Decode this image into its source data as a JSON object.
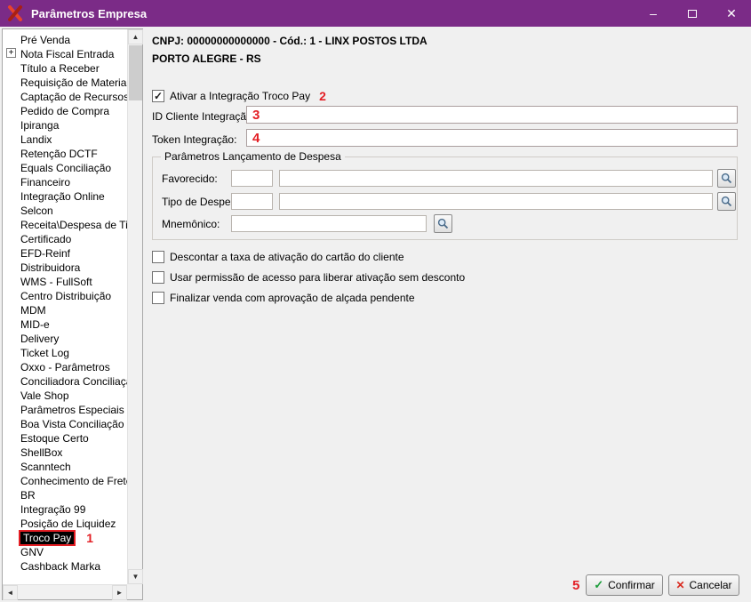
{
  "window": {
    "title": "Parâmetros Empresa"
  },
  "icons": {
    "minimize": "–",
    "close": "✕",
    "scroll_up": "▲",
    "scroll_down": "▼",
    "scroll_left": "◄",
    "scroll_right": "►",
    "expand": "+",
    "check": "✓",
    "cancel_x": "✕"
  },
  "colors": {
    "titlebar": "#7b2b87",
    "annotation_red": "#e31e24",
    "selected_item_bg": "#000000"
  },
  "sidebar": {
    "items": [
      {
        "label": "Pré Venda"
      },
      {
        "label": "Nota Fiscal Entrada",
        "expandable": true
      },
      {
        "label": "Título a Receber"
      },
      {
        "label": "Requisição de Materiais"
      },
      {
        "label": "Captação de Recursos"
      },
      {
        "label": "Pedido de Compra"
      },
      {
        "label": "Ipiranga"
      },
      {
        "label": "Landix"
      },
      {
        "label": "Retenção DCTF"
      },
      {
        "label": "Equals Conciliação"
      },
      {
        "label": "Financeiro"
      },
      {
        "label": "Integração Online"
      },
      {
        "label": "Selcon"
      },
      {
        "label": "Receita\\Despesa de Titul"
      },
      {
        "label": "Certificado"
      },
      {
        "label": "EFD-Reinf"
      },
      {
        "label": "Distribuidora"
      },
      {
        "label": "WMS - FullSoft"
      },
      {
        "label": "Centro Distribuição"
      },
      {
        "label": "MDM"
      },
      {
        "label": "MID-e"
      },
      {
        "label": "Delivery"
      },
      {
        "label": "Ticket Log"
      },
      {
        "label": "Oxxo - Parâmetros"
      },
      {
        "label": "Conciliadora Conciliação"
      },
      {
        "label": "Vale Shop"
      },
      {
        "label": "Parâmetros Especiais"
      },
      {
        "label": "Boa Vista Conciliação"
      },
      {
        "label": "Estoque Certo"
      },
      {
        "label": "ShellBox"
      },
      {
        "label": "Scanntech"
      },
      {
        "label": "Conhecimento de Frete"
      },
      {
        "label": "BR"
      },
      {
        "label": "Integração 99"
      },
      {
        "label": "Posição de Liquidez"
      },
      {
        "label": "Troco Pay",
        "selected": true,
        "annotation": "1"
      },
      {
        "label": "GNV"
      },
      {
        "label": "Cashback Marka"
      }
    ]
  },
  "main": {
    "company_line": "CNPJ: 00000000000000 - Cód.: 1 - LINX POSTOS LTDA",
    "city_line": "PORTO ALEGRE - RS",
    "activate": {
      "label": "Ativar a Integração Troco Pay",
      "checked": true,
      "annotation": "2"
    },
    "fields": {
      "id_cliente": {
        "label": "ID Cliente Integração:",
        "value": "",
        "annotation": "3"
      },
      "token": {
        "label": "Token Integração:",
        "value": "",
        "annotation": "4"
      }
    },
    "despesa_group": {
      "title": "Parâmetros Lançamento de Despesa",
      "favorecido": {
        "label": "Favorecido:",
        "code": "",
        "name": ""
      },
      "tipo_despesa": {
        "label": "Tipo de Despesa:",
        "code": "",
        "name": ""
      },
      "mnemonico": {
        "label": "Mnemônico:",
        "value": ""
      }
    },
    "options": [
      {
        "label": "Descontar a taxa de ativação do cartão do cliente",
        "checked": false
      },
      {
        "label": "Usar permissão de acesso para liberar ativação sem desconto",
        "checked": false
      },
      {
        "label": "Finalizar venda com aprovação de alçada pendente",
        "checked": false
      }
    ]
  },
  "footer": {
    "annotation": "5",
    "confirm": "Confirmar",
    "cancel": "Cancelar"
  }
}
